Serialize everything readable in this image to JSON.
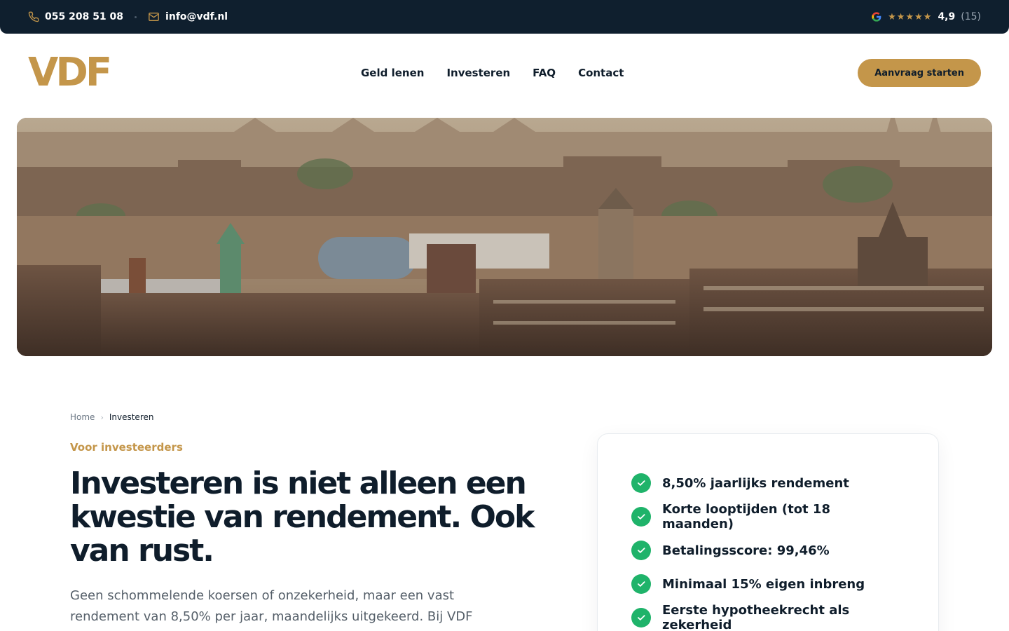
{
  "topbar": {
    "phone": "055 208 51 08",
    "email": "info@vdf.nl",
    "rating": {
      "stars": "★★★★★",
      "score": "4,9",
      "count": "(15)"
    }
  },
  "header": {
    "logo": "VDF",
    "nav": [
      "Geld lenen",
      "Investeren",
      "FAQ",
      "Contact"
    ],
    "cta": "Aanvraag starten"
  },
  "breadcrumb": {
    "home": "Home",
    "current": "Investeren"
  },
  "main": {
    "eyebrow": "Voor investeerders",
    "headline": "Investeren is niet alleen een kwestie van rendement. Ook van rust.",
    "intro": "Geen schommelende koersen of onzekerheid, maar een vast rendement van 8,50% per jaar, maandelijks uitgekeerd. Bij VDF"
  },
  "features": [
    "8,50% jaarlijks rendement",
    "Korte looptijden (tot 18 maanden)",
    "Betalingsscore: 99,46%",
    "Minimaal 15% eigen inbreng",
    "Eerste hypotheekrecht als zekerheid"
  ],
  "colors": {
    "navy": "#0f1f2e",
    "gold": "#c4964a",
    "green": "#1fb36a"
  }
}
